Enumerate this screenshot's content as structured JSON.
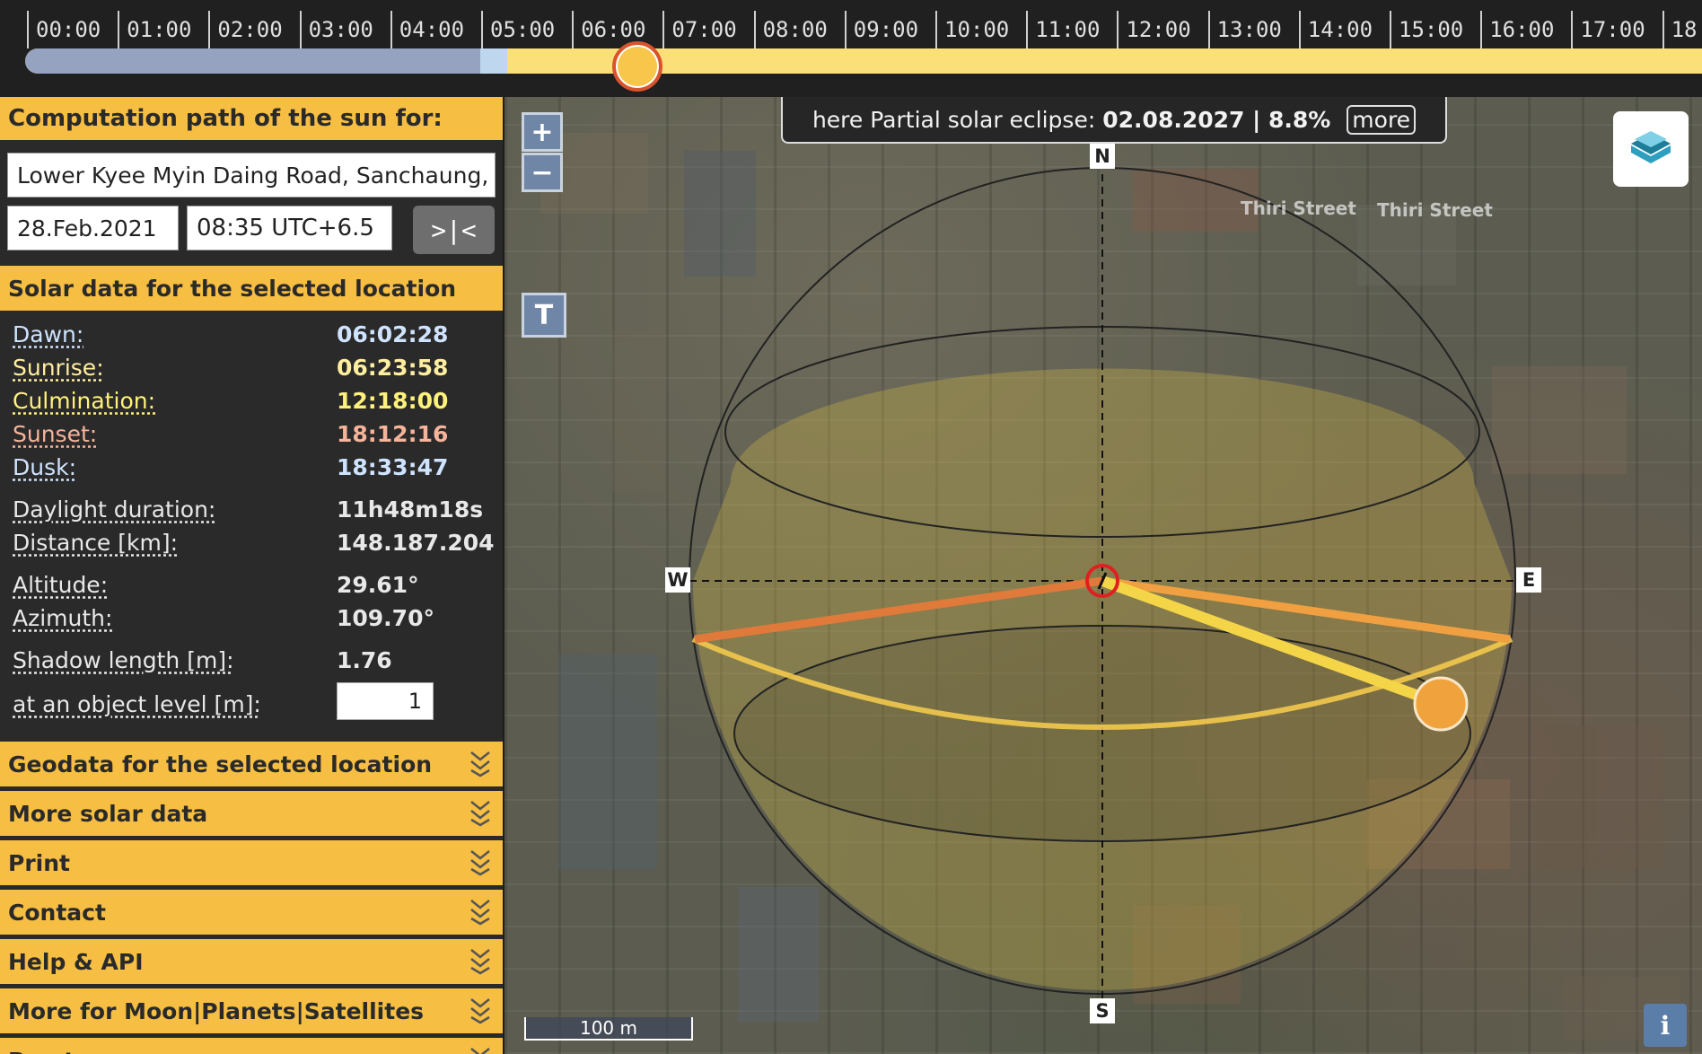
{
  "timeline": {
    "ticks": [
      "00:00",
      "01:00",
      "02:00",
      "03:00",
      "04:00",
      "05:00",
      "06:00",
      "07:00",
      "08:00",
      "09:00",
      "10:00",
      "11:00",
      "12:00",
      "13:00",
      "14:00",
      "15:00",
      "16:00",
      "17:00",
      "18"
    ],
    "current_time_fraction": 0.359
  },
  "sidebar": {
    "computation_header": "Computation path of the sun for:",
    "location_value": "Lower Kyee Myin Daing Road, Sanchaung, Ya",
    "date_value": "28.Feb.2021",
    "time_value": "08:35 UTC+6.5",
    "swap_label": ">|<",
    "solar_header": "Solar data for the selected location",
    "rows": [
      {
        "label": "Dawn:",
        "value": "06:02:28",
        "label_color": "#cfe3ff",
        "value_color": "#cfe3ff"
      },
      {
        "label": "Sunrise:",
        "value": "06:23:58",
        "label_color": "#ffeea0",
        "value_color": "#ffeea0"
      },
      {
        "label": "Culmination:",
        "value": "12:18:00",
        "label_color": "#fff27a",
        "value_color": "#fff27a"
      },
      {
        "label": "Sunset:",
        "value": "18:12:16",
        "label_color": "#f6b49a",
        "value_color": "#f6b49a"
      },
      {
        "label": "Dusk:",
        "value": "18:33:47",
        "label_color": "#cfe3ff",
        "value_color": "#cfe3ff"
      },
      {
        "label": "Daylight duration:",
        "value": "11h48m18s"
      },
      {
        "label": "Distance [km]:",
        "value": "148.187.204"
      },
      {
        "label": "Altitude:",
        "value": "29.61°"
      },
      {
        "label": "Azimuth:",
        "value": "109.70°"
      },
      {
        "label": "Shadow length [m]:",
        "value": "1.76"
      },
      {
        "label": "at an object level [m]:"
      }
    ],
    "object_level_value": "1",
    "accordions": [
      "Geodata for the selected location",
      "More solar data",
      "Print",
      "Contact",
      "Help & API",
      "More for Moon|Planets|Satellites",
      "Pract"
    ]
  },
  "map": {
    "zoom_in": "+",
    "zoom_out": "−",
    "tool_t": "T",
    "eclipse_prefix": "here Partial solar eclipse:",
    "eclipse_value": "02.08.2027 | 8.8%",
    "eclipse_more": "more",
    "compass": {
      "n": "N",
      "s": "S",
      "e": "E",
      "w": "W"
    },
    "scale_label": "100 m",
    "info_label": "i",
    "labels": [
      "Thiri Street",
      "Thiri Street"
    ]
  },
  "colors": {
    "accent": "#f6be42",
    "sunrise_line": "#e07a3a",
    "sunset_line": "#f0a040",
    "current_sun_line": "#f5d548",
    "sun_path": "#f2c94c"
  }
}
